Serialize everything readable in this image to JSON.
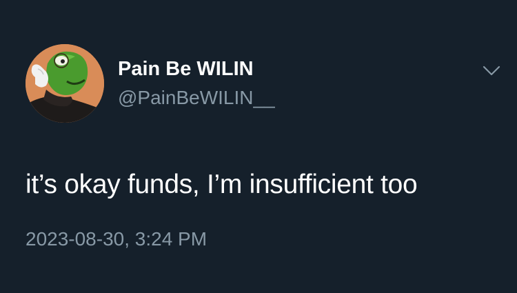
{
  "tweet": {
    "author": {
      "display_name": "Pain Be WILIN",
      "handle": "@PainBeWILIN__",
      "avatar_icon": "kermit-avatar"
    },
    "menu_icon": "chevron-down-icon",
    "text": "it’s okay funds, I’m insufficient too",
    "timestamp": "2023-08-30, 3:24 PM"
  },
  "colors": {
    "background": "#15202b",
    "primary_text": "#ffffff",
    "secondary_text": "#8899a6",
    "avatar_bg": "#d98c58"
  }
}
